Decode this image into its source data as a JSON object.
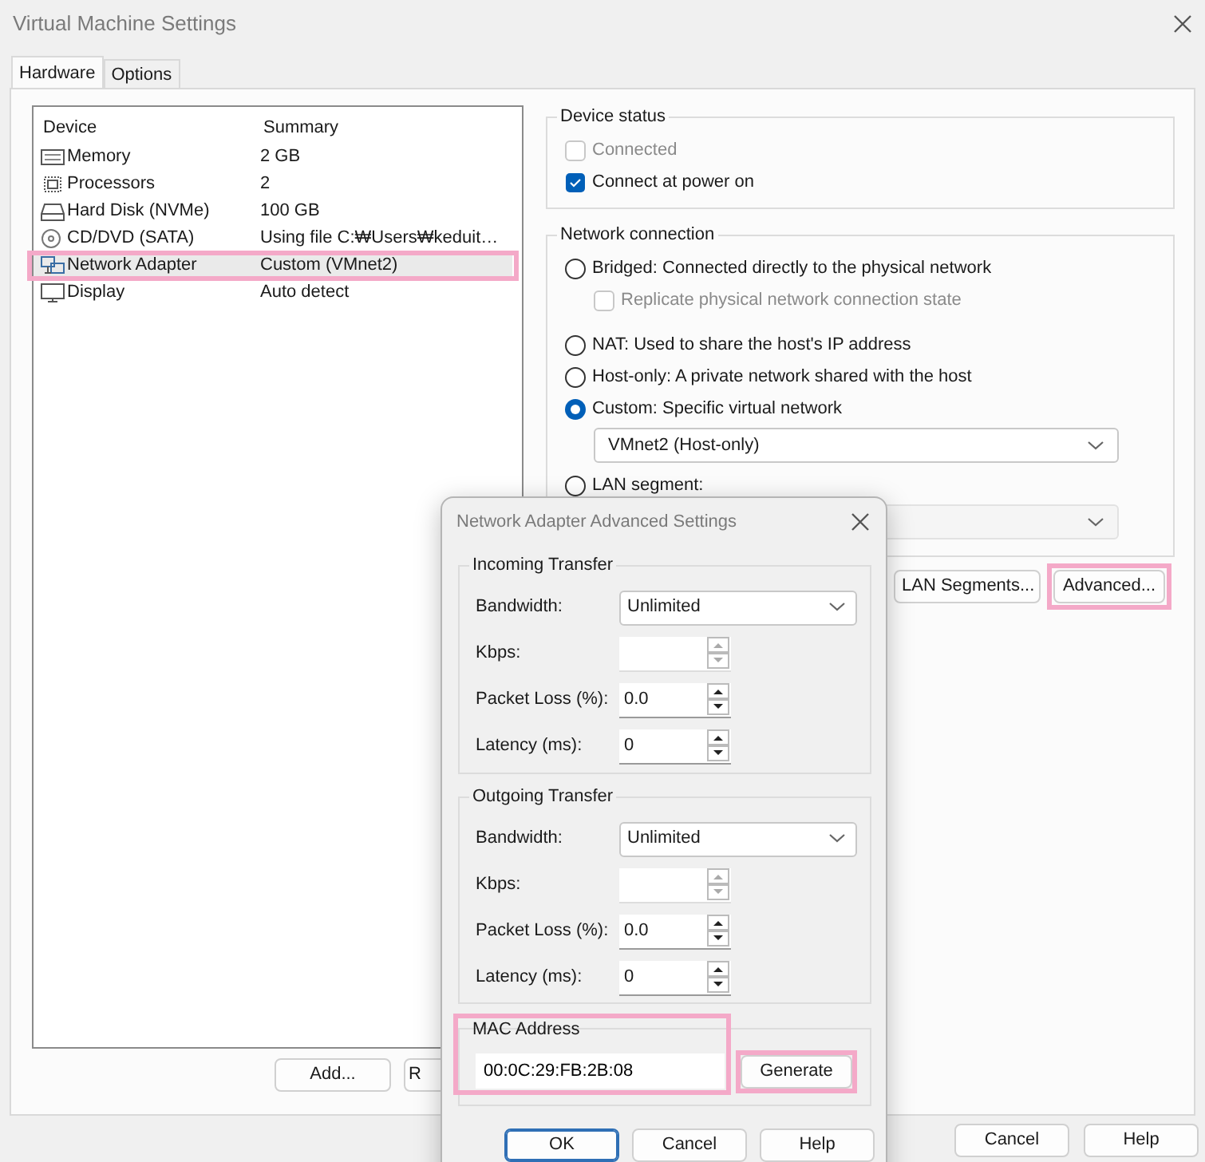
{
  "window": {
    "title": "Virtual Machine Settings"
  },
  "tabs": [
    {
      "label": "Hardware",
      "selected": true
    },
    {
      "label": "Options",
      "selected": false
    }
  ],
  "device_list": {
    "columns": [
      "Device",
      "Summary"
    ],
    "rows": [
      {
        "kind": "memory",
        "device": "Memory",
        "summary": "2 GB",
        "selected": false,
        "highlighted": false
      },
      {
        "kind": "processor",
        "device": "Processors",
        "summary": "2",
        "selected": false,
        "highlighted": false
      },
      {
        "kind": "disk",
        "device": "Hard Disk (NVMe)",
        "summary": "100 GB",
        "selected": false,
        "highlighted": false
      },
      {
        "kind": "cd",
        "device": "CD/DVD (SATA)",
        "summary": "Using file C:₩Users₩keduit…",
        "selected": false,
        "highlighted": false
      },
      {
        "kind": "network",
        "device": "Network Adapter",
        "summary": "Custom (VMnet2)",
        "selected": true,
        "highlighted": true
      },
      {
        "kind": "display",
        "device": "Display",
        "summary": "Auto detect",
        "selected": false,
        "highlighted": false
      }
    ]
  },
  "device_buttons": [
    "Add...",
    "R"
  ],
  "device_status": {
    "title": "Device status",
    "options": [
      {
        "label": "Connected",
        "checked": false,
        "disabled": true
      },
      {
        "label": "Connect at power on",
        "checked": true,
        "disabled": false
      }
    ]
  },
  "network_connection": {
    "title": "Network connection",
    "options": [
      {
        "kind": "radio",
        "label": "Bridged: Connected directly to the physical network",
        "selected": false
      },
      {
        "kind": "checkbox",
        "label": "Replicate physical network connection state",
        "checked": false,
        "disabled": true
      },
      {
        "kind": "radio",
        "label": "NAT: Used to share the host's IP address",
        "selected": false
      },
      {
        "kind": "radio",
        "label": "Host-only: A private network shared with the host",
        "selected": false
      },
      {
        "kind": "radio",
        "label": "Custom: Specific virtual network",
        "selected": true
      },
      {
        "kind": "select",
        "value": "VMnet2 (Host-only)",
        "disabled": false
      },
      {
        "kind": "radio",
        "label": "LAN segment:",
        "selected": false
      },
      {
        "kind": "select",
        "disabled": true
      }
    ]
  },
  "network_buttons": [
    {
      "label": "LAN Segments...",
      "highlighted": false
    },
    {
      "label": "Advanced...",
      "highlighted": true
    }
  ],
  "footer_buttons": [
    "Cancel",
    "Help"
  ],
  "advanced_dialog": {
    "title": "Network Adapter Advanced Settings",
    "groups": [
      {
        "title": "Incoming Transfer",
        "bandwidth_label": "Bandwidth:",
        "bandwidth": "Unlimited",
        "fields": [
          {
            "label": "Kbps:",
            "disabled": true
          },
          {
            "label": "Packet Loss (%):",
            "value": "0.0",
            "disabled": false
          },
          {
            "label": "Latency (ms):",
            "value": "0",
            "disabled": false
          }
        ]
      },
      {
        "title": "Outgoing Transfer",
        "bandwidth_label": "Bandwidth:",
        "bandwidth": "Unlimited",
        "fields": [
          {
            "label": "Kbps:",
            "disabled": true
          },
          {
            "label": "Packet Loss (%):",
            "value": "0.0",
            "disabled": false
          },
          {
            "label": "Latency (ms):",
            "value": "0",
            "disabled": false
          }
        ]
      }
    ],
    "mac": {
      "title": "MAC Address",
      "value": "00:0C:29:FB:2B:08",
      "highlighted": true
    },
    "generate": {
      "label": "Generate",
      "highlighted": true
    },
    "buttons": [
      {
        "label": "OK",
        "default": true
      },
      {
        "label": "Cancel",
        "default": false
      },
      {
        "label": "Help",
        "default": false
      }
    ]
  }
}
